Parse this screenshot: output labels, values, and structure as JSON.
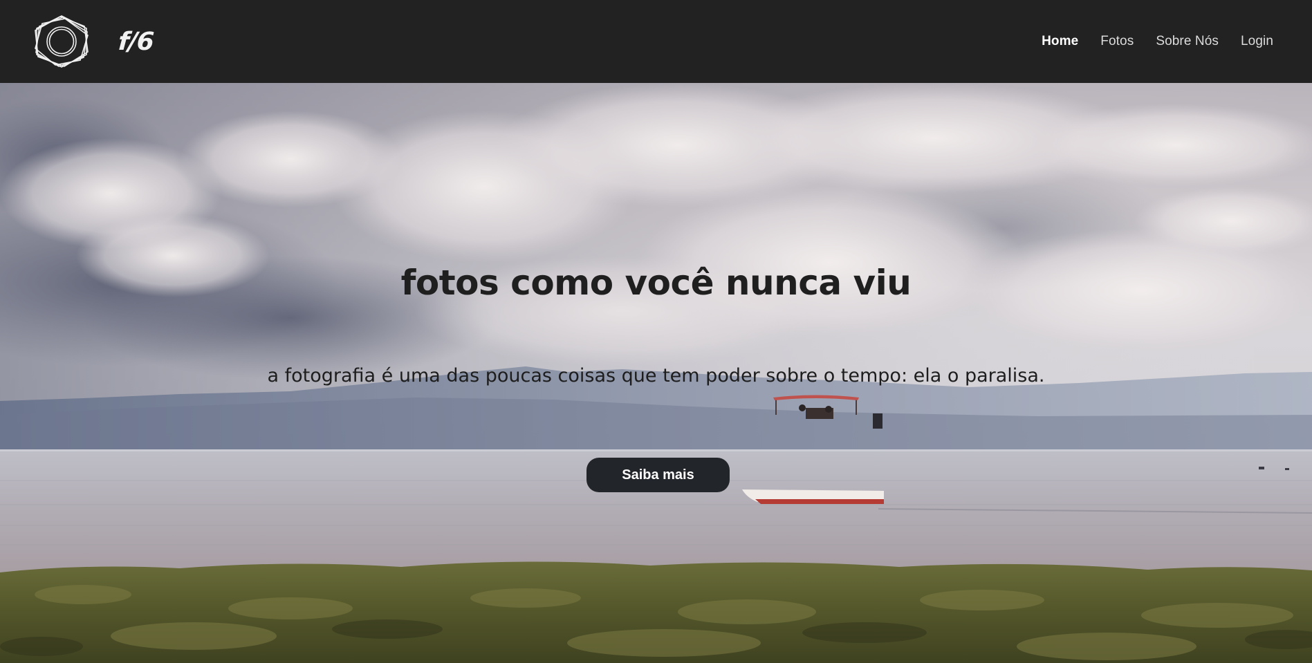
{
  "header": {
    "logo_icon": "aperture-hexagon-icon",
    "brand": "f/6",
    "nav": [
      {
        "label": "Home",
        "active": true
      },
      {
        "label": "Fotos",
        "active": false
      },
      {
        "label": "Sobre Nós",
        "active": false
      },
      {
        "label": "Login",
        "active": false
      }
    ]
  },
  "hero": {
    "title": "fotos como você nunca viu",
    "subtitle": "a fotografia é uma das poucas coisas que tem poder sobre o tempo: ela o paralisa.",
    "cta_label": "Saiba mais"
  },
  "colors": {
    "navbar": "#222222",
    "button": "#22252a",
    "text_dark": "#1f1f1f",
    "nav_text": "#dcdcdc"
  }
}
